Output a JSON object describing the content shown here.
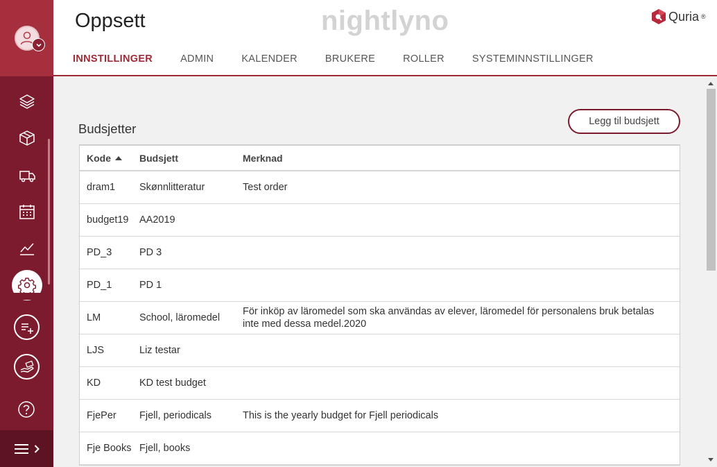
{
  "app": {
    "page_title": "Oppsett",
    "brand_watermark": "nightlyno",
    "logo_text": "Quria",
    "logo_mark": "®",
    "accent_color": "#9e2a37"
  },
  "tabs": [
    {
      "label": "INNSTILLINGER",
      "active": true
    },
    {
      "label": "ADMIN",
      "active": false
    },
    {
      "label": "KALENDER",
      "active": false
    },
    {
      "label": "BRUKERE",
      "active": false
    },
    {
      "label": "ROLLER",
      "active": false
    },
    {
      "label": "SYSTEMINNSTILLINGER",
      "active": false
    }
  ],
  "sidebar": {
    "icons": [
      "layers-icon",
      "box-icon",
      "truck-icon",
      "calendar-icon",
      "chart-icon",
      "gear-icon",
      "add-list-icon",
      "hand-money-icon",
      "help-icon",
      "menu-icon"
    ]
  },
  "budgets": {
    "title": "Budsjetter",
    "add_button": "Legg til budsjett",
    "columns": [
      "Kode",
      "Budsjett",
      "Merknad"
    ],
    "rows": [
      {
        "kode": "dram1",
        "budsjett": "Skønnlitteratur",
        "merknad": "Test order"
      },
      {
        "kode": "budget19",
        "budsjett": "AA2019",
        "merknad": ""
      },
      {
        "kode": "PD_3",
        "budsjett": "PD 3",
        "merknad": ""
      },
      {
        "kode": "PD_1",
        "budsjett": "PD 1",
        "merknad": ""
      },
      {
        "kode": "LM",
        "budsjett": "School, läromedel",
        "merknad": "För inköp av läromedel som ska användas av elever, läromedel för personalens bruk betalas inte med dessa medel.2020"
      },
      {
        "kode": "LJS",
        "budsjett": "Liz testar",
        "merknad": ""
      },
      {
        "kode": "KD",
        "budsjett": "KD test budget",
        "merknad": ""
      },
      {
        "kode": "FjePer",
        "budsjett": "Fjell, periodicals",
        "merknad": "This is the yearly budget for Fjell periodicals"
      },
      {
        "kode": "Fje Books",
        "budsjett": "Fjell, books",
        "merknad": ""
      }
    ]
  }
}
